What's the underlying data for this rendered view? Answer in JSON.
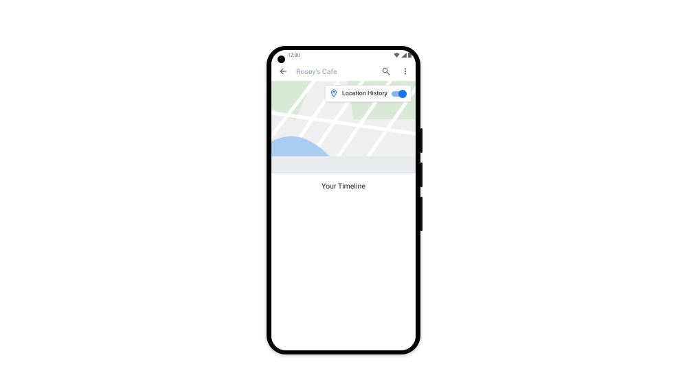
{
  "status": {
    "time": "12:00"
  },
  "appbar": {
    "search_text": "Rosey's Cafe"
  },
  "chip": {
    "label": "Location History",
    "toggle_on": true
  },
  "timeline": {
    "title": "Your Timeline"
  },
  "colors": {
    "accent": "#1a73e8",
    "map_green": "#d6ead6",
    "map_water": "#a8cdf2",
    "map_road": "#ffffff",
    "map_bg": "#efefef"
  }
}
